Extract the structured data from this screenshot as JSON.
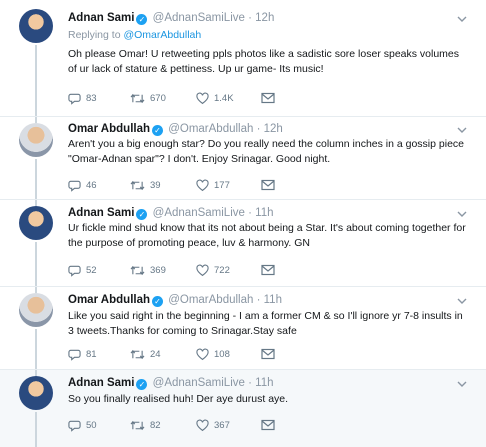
{
  "tweets": [
    {
      "name": "Adnan Sami",
      "handle": "@AdnanSamiLive",
      "dot": "·",
      "time": "12h",
      "replying_prefix": "Replying to",
      "replying_to": "@OmarAbdullah",
      "text": "Oh please Omar! U retweeting ppls photos like a sadistic sore loser speaks volumes of ur lack of stature & pettiness. Up ur game- Its music!",
      "replies": "83",
      "retweets": "670",
      "likes": "1.4K"
    },
    {
      "name": "Omar Abdullah",
      "handle": "@OmarAbdullah",
      "dot": "·",
      "time": "12h",
      "text": "Aren't you a big enough star? Do you really need the column inches in a gossip piece \"Omar-Adnan spar\"? I don't. Enjoy Srinagar. Good night.",
      "replies": "46",
      "retweets": "39",
      "likes": "177"
    },
    {
      "name": "Adnan Sami",
      "handle": "@AdnanSamiLive",
      "dot": "·",
      "time": "11h",
      "text": "Ur fickle mind shud know that its not about being a Star. It's about coming together for the purpose of promoting peace, luv & harmony. GN",
      "replies": "52",
      "retweets": "369",
      "likes": "722"
    },
    {
      "name": "Omar Abdullah",
      "handle": "@OmarAbdullah",
      "dot": "·",
      "time": "11h",
      "text": "Like you said right in the beginning - I am a former CM & so I'll ignore yr 7-8 insults in 3 tweets.Thanks for coming to Srinagar.Stay safe",
      "replies": "81",
      "retweets": "24",
      "likes": "108"
    },
    {
      "name": "Adnan Sami",
      "handle": "@AdnanSamiLive",
      "dot": "·",
      "time": "11h",
      "text": "So you finally realised huh! Der aye durust aye.",
      "replies": "50",
      "retweets": "82",
      "likes": "367"
    }
  ],
  "icons": {
    "reply": "reply-icon",
    "retweet": "retweet-icon",
    "like": "heart-icon",
    "dm": "envelope-icon",
    "more": "chevron-down-icon",
    "verified": "verified-badge-icon"
  },
  "colors": {
    "verified": "#1da1f2",
    "mention": "#1b95e0",
    "meta": "#8a96a3",
    "thread_line": "#ccd6dd"
  }
}
